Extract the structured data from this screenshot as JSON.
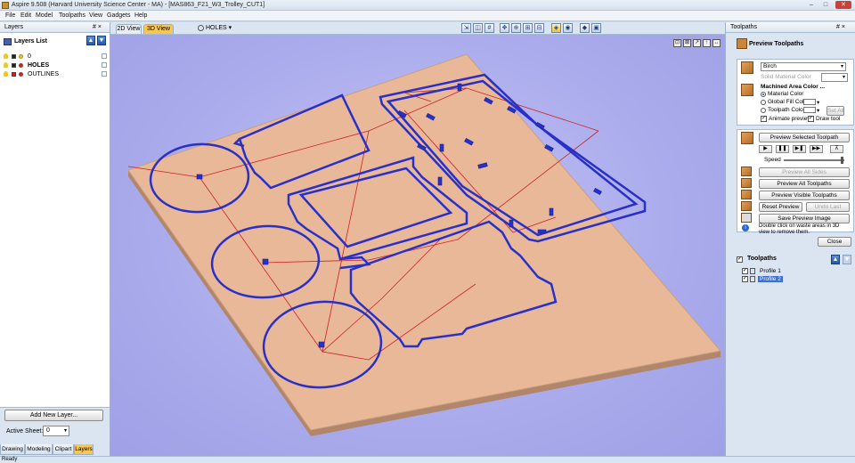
{
  "window": {
    "title": "Aspire 9.508 (Harvard University Science Center - MA) - [MAS863_F21_W3_Trolley_CUT1]",
    "controls": [
      "–",
      "□",
      "✕"
    ]
  },
  "menu": [
    "File",
    "Edit",
    "Model",
    "Toolpaths",
    "View",
    "Gadgets",
    "Help"
  ],
  "left_panel": {
    "header": "Layers",
    "pin": "# ×",
    "list_title": "Layers List",
    "layers": [
      {
        "name": "0",
        "color": "#f2c624"
      },
      {
        "name": "HOLES",
        "color": "#cc2222"
      },
      {
        "name": "OUTLINES",
        "color": "#cc2222"
      }
    ],
    "add_layer_button": "Add New Layer...",
    "active_sheet_label": "Active Sheet:",
    "active_sheet_value": "0",
    "tabs": [
      "Drawing",
      "Modeling",
      "Clipart",
      "Layers"
    ],
    "active_tab": "Layers"
  },
  "view_tabs": {
    "tabs": [
      "2D View",
      "3D View"
    ],
    "active": "3D View",
    "layer_dropdown": "HOLES"
  },
  "toolbar_icons": [
    "view-2d-icon",
    "view-iso-icon",
    "grid-icon",
    "snap-icon",
    "zoom-fit-icon",
    "zoom-in-icon",
    "zoom-out-icon",
    "shade-icon",
    "toolpath-visible-icon",
    "material-icon",
    "render-icon"
  ],
  "nav_icons": [
    "⊡",
    "⊠",
    "↗",
    "↑",
    "↔",
    "↕",
    "⇱"
  ],
  "right_panel": {
    "header": "Toolpaths",
    "pin": "# ×",
    "preview_title": "Preview Toolpaths",
    "material": "Birch",
    "solid_material_color_label": "Solid Material Color",
    "machined_area_label": "Machined Area Color ...",
    "color_options": [
      "Material Color",
      "Global Fill Color",
      "Toolpath Color"
    ],
    "color_selected": "Material Color",
    "set_all": "Set All",
    "animate_preview": "Animate preview",
    "draw_tool": "Draw tool",
    "preview_selected_button": "Preview Selected Toolpath",
    "play_buttons": [
      "▶",
      "❚❚",
      "▶❚",
      "▶▶",
      "⊼"
    ],
    "speed_label": "Speed",
    "speed_fraction": 0.96,
    "preview_all_sides": "Preview All Sides",
    "preview_all_toolpaths": "Preview All Toolpaths",
    "preview_visible_toolpaths": "Preview Visible Toolpaths",
    "reset_preview": "Reset Preview",
    "undo_last": "Undo Last",
    "save_preview_image": "Save Preview Image",
    "hint": "Double click on waste areas in 3D view to remove them.",
    "close": "Close",
    "toolpaths_title": "Toolpaths",
    "toolpaths": [
      {
        "name": "Profile 1",
        "selected": false
      },
      {
        "name": "Profile 2",
        "selected": true
      }
    ]
  },
  "status": "Ready",
  "colors": {
    "background": "#aaabec",
    "wood": "#e8b898",
    "toolpath": "#2830c8",
    "rapid": "#cc2222",
    "accent_tab": "#f7c655"
  }
}
